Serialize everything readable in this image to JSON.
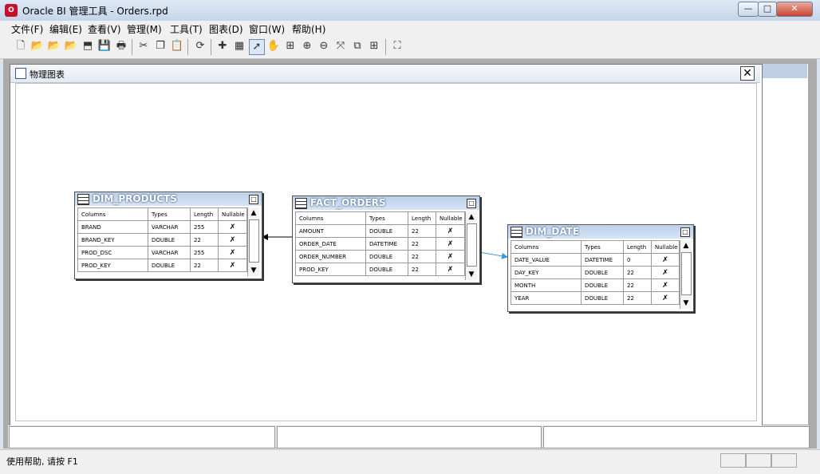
{
  "window": {
    "title": "Oracle BI 管理工具 - Orders.rpd",
    "icon_label": "O",
    "buttons": {
      "minimize": "—",
      "maximize": "□",
      "close": "✕"
    }
  },
  "menu": [
    "文件(F)",
    "编辑(E)",
    "查看(V)",
    "管理(M)",
    "工具(T)",
    "图表(D)",
    "窗口(W)",
    "帮助(H)"
  ],
  "toolbar": {
    "icons": [
      "new-document-icon",
      "open-folder-icon",
      "open-online-icon",
      "open-cache-icon",
      "checkin-icon",
      "save-icon",
      "print-icon",
      "cut-icon",
      "copy-icon",
      "paste-icon",
      "refresh-icon",
      "new-object-icon",
      "import-icon",
      "select-pointer-icon",
      "hand-pan-icon",
      "zoom-fit-icon",
      "zoom-in-icon",
      "zoom-out-icon",
      "new-join-icon",
      "new-complex-join-icon",
      "add-table-icon",
      "auto-layout-icon"
    ],
    "glyphs": [
      "🗋",
      "📂",
      "📂",
      "📂",
      "⬒",
      "💾",
      "🖶",
      "✂",
      "❐",
      "📋",
      "⟳",
      "✚",
      "▦",
      "➚",
      "✋",
      "⊞",
      "⊕",
      "⊖",
      "⤧",
      "⧉",
      "⊞",
      "⛶"
    ]
  },
  "diagram": {
    "title": "物理图表",
    "close_label": "✕",
    "tables": [
      {
        "name": "DIM_PRODUCTS",
        "headers": [
          "Columns",
          "Types",
          "Length",
          "Nullable"
        ],
        "rows": [
          [
            "BRAND",
            "VARCHAR",
            "255",
            "✗"
          ],
          [
            "BRAND_KEY",
            "DOUBLE",
            "22",
            "✗"
          ],
          [
            "PROD_DSC",
            "VARCHAR",
            "255",
            "✗"
          ],
          [
            "PROD_KEY",
            "DOUBLE",
            "22",
            "✗"
          ]
        ]
      },
      {
        "name": "FACT_ORDERS",
        "headers": [
          "Columns",
          "Types",
          "Length",
          "Nullable"
        ],
        "rows": [
          [
            "AMOUNT",
            "DOUBLE",
            "22",
            "✗"
          ],
          [
            "ORDER_DATE",
            "DATETIME",
            "22",
            "✗"
          ],
          [
            "ORDER_NUMBER",
            "DOUBLE",
            "22",
            "✗"
          ],
          [
            "PROD_KEY",
            "DOUBLE",
            "22",
            "✗"
          ]
        ]
      },
      {
        "name": "DIM_DATE",
        "headers": [
          "Columns",
          "Types",
          "Length",
          "Nullable"
        ],
        "rows": [
          [
            "DATE_VALUE",
            "DATETIME",
            "0",
            "✗"
          ],
          [
            "DAY_KEY",
            "DOUBLE",
            "22",
            "✗"
          ],
          [
            "MONTH",
            "DOUBLE",
            "22",
            "✗"
          ],
          [
            "YEAR",
            "DOUBLE",
            "22",
            "✗"
          ]
        ]
      }
    ],
    "join_colors": {
      "products": "#000000",
      "date": "#3a9ad9"
    }
  },
  "status": {
    "text": "使用帮助, 请按 F1"
  }
}
